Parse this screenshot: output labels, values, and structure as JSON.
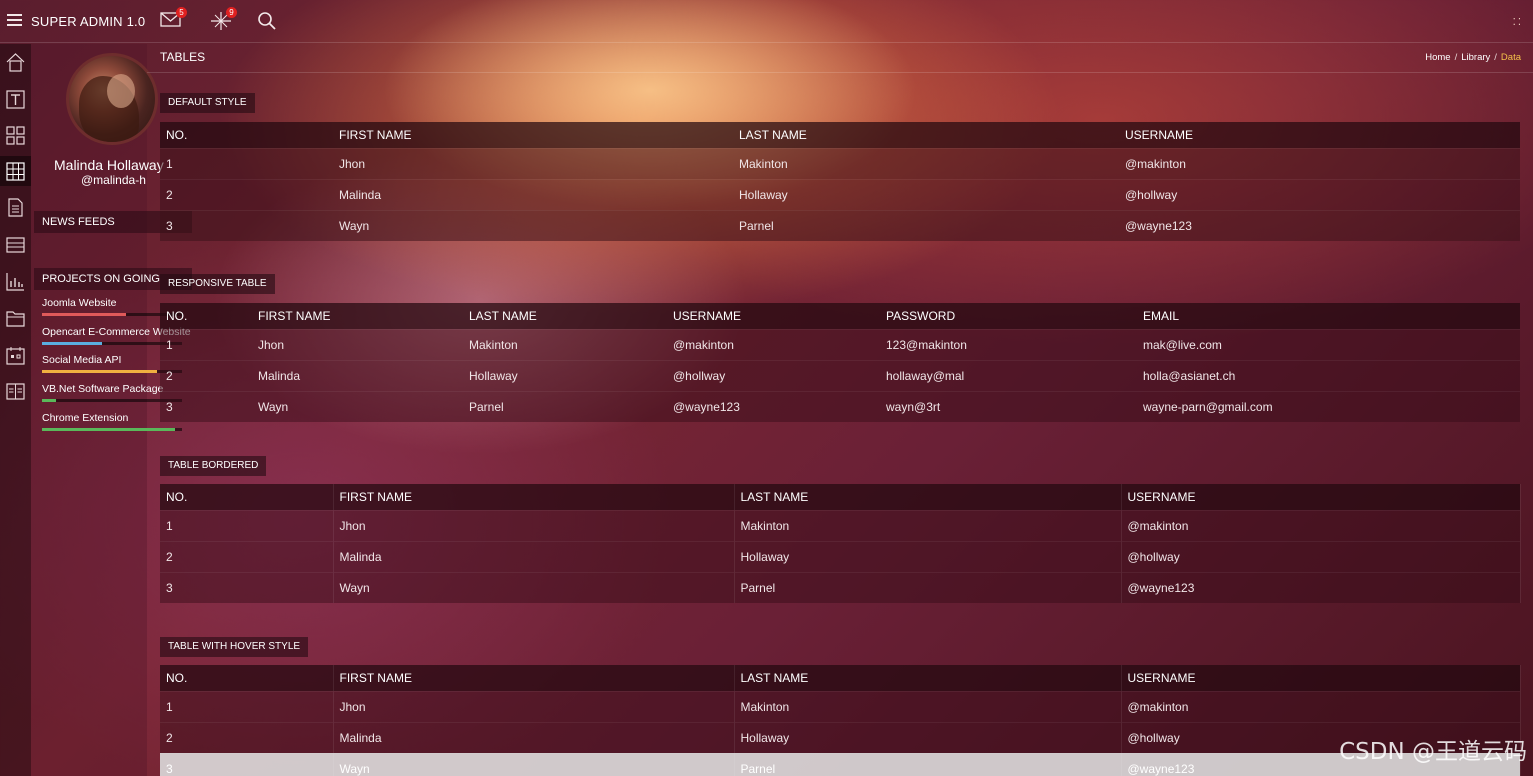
{
  "header": {
    "app_title": "SUPER ADMIN 1.0",
    "mail_badge": "5",
    "notif_badge": "9",
    "icons": [
      "menu-icon",
      "mail-icon",
      "sparkle-icon",
      "search-icon",
      "fullscreen-icon"
    ]
  },
  "rail": {
    "icons": [
      "home-icon",
      "typography-icon",
      "grid-icon",
      "table-icon",
      "document-icon",
      "layers-icon",
      "chart-icon",
      "folder-icon",
      "calendar-icon",
      "columns-icon"
    ]
  },
  "profile": {
    "name": "Malinda Hollaway",
    "handle": "@malinda-h",
    "news_heading": "NEWS FEEDS",
    "projects_heading": "PROJECTS ON GOING",
    "projects": [
      {
        "label": "Joomla Website",
        "progress": 0.6,
        "color": "#e05a5a"
      },
      {
        "label": "Opencart E-Commerce Website",
        "progress": 0.43,
        "color": "#5aaee0"
      },
      {
        "label": "Social Media API",
        "progress": 0.82,
        "color": "#f0b040"
      },
      {
        "label": "VB.Net Software Package",
        "progress": 0.1,
        "color": "#5ab85a"
      },
      {
        "label": "Chrome Extension",
        "progress": 0.95,
        "color": "#5ab85a"
      }
    ]
  },
  "page": {
    "title": "TABLES",
    "breadcrumb": [
      "Home",
      "Library",
      "Data"
    ],
    "sep": "/"
  },
  "tables": {
    "default": {
      "tag": "DEFAULT STYLE",
      "headers": [
        "NO.",
        "FIRST NAME",
        "LAST NAME",
        "USERNAME"
      ],
      "rows": [
        [
          "1",
          "Jhon",
          "Makinton",
          "@makinton"
        ],
        [
          "2",
          "Malinda",
          "Hollaway",
          "@hollway"
        ],
        [
          "3",
          "Wayn",
          "Parnel",
          "@wayne123"
        ]
      ]
    },
    "responsive": {
      "tag": "RESPONSIVE TABLE",
      "headers": [
        "NO.",
        "FIRST NAME",
        "LAST NAME",
        "USERNAME",
        "PASSWORD",
        "EMAIL"
      ],
      "rows": [
        [
          "1",
          "Jhon",
          "Makinton",
          "@makinton",
          "123@makinton",
          "mak@live.com"
        ],
        [
          "2",
          "Malinda",
          "Hollaway",
          "@hollway",
          "hollaway@mal",
          "holla@asianet.ch"
        ],
        [
          "3",
          "Wayn",
          "Parnel",
          "@wayne123",
          "wayn@3rt",
          "wayne-parn@gmail.com"
        ]
      ]
    },
    "bordered": {
      "tag": "TABLE BORDERED",
      "headers": [
        "NO.",
        "FIRST NAME",
        "LAST NAME",
        "USERNAME"
      ],
      "rows": [
        [
          "1",
          "Jhon",
          "Makinton",
          "@makinton"
        ],
        [
          "2",
          "Malinda",
          "Hollaway",
          "@hollway"
        ],
        [
          "3",
          "Wayn",
          "Parnel",
          "@wayne123"
        ]
      ]
    },
    "hover": {
      "tag": "TABLE WITH HOVER STYLE",
      "headers": [
        "NO.",
        "FIRST NAME",
        "LAST NAME",
        "USERNAME"
      ],
      "rows": [
        [
          "1",
          "Jhon",
          "Makinton",
          "@makinton"
        ],
        [
          "2",
          "Malinda",
          "Hollaway",
          "@hollway"
        ],
        [
          "3",
          "Wayn",
          "Parnel",
          "@wayne123"
        ]
      ]
    }
  },
  "watermark": "CSDN @王道云码"
}
